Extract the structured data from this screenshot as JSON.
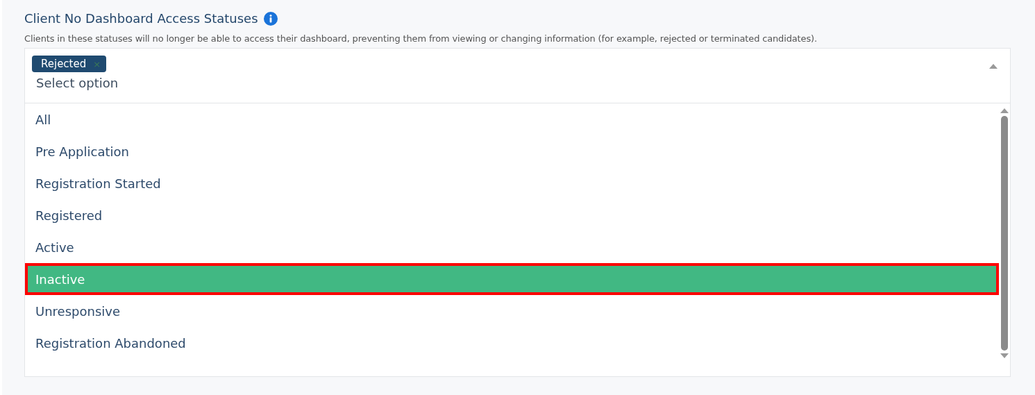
{
  "section": {
    "title": "Client No Dashboard Access Statuses",
    "description": "Clients in these statuses will no longer be able to access their dashboard, preventing them from viewing or changing information (for example, rejected or terminated candidates)."
  },
  "select": {
    "tags": [
      {
        "label": "Rejected",
        "remove": "×"
      }
    ],
    "placeholder": "Select option",
    "expanded": true,
    "options": [
      {
        "label": "All",
        "selected": false
      },
      {
        "label": "Pre Application",
        "selected": false
      },
      {
        "label": "Registration Started",
        "selected": false
      },
      {
        "label": "Registered",
        "selected": false
      },
      {
        "label": "Active",
        "selected": false
      },
      {
        "label": "Inactive",
        "selected": true
      },
      {
        "label": "Unresponsive",
        "selected": false
      },
      {
        "label": "Registration Abandoned",
        "selected": false
      }
    ]
  }
}
